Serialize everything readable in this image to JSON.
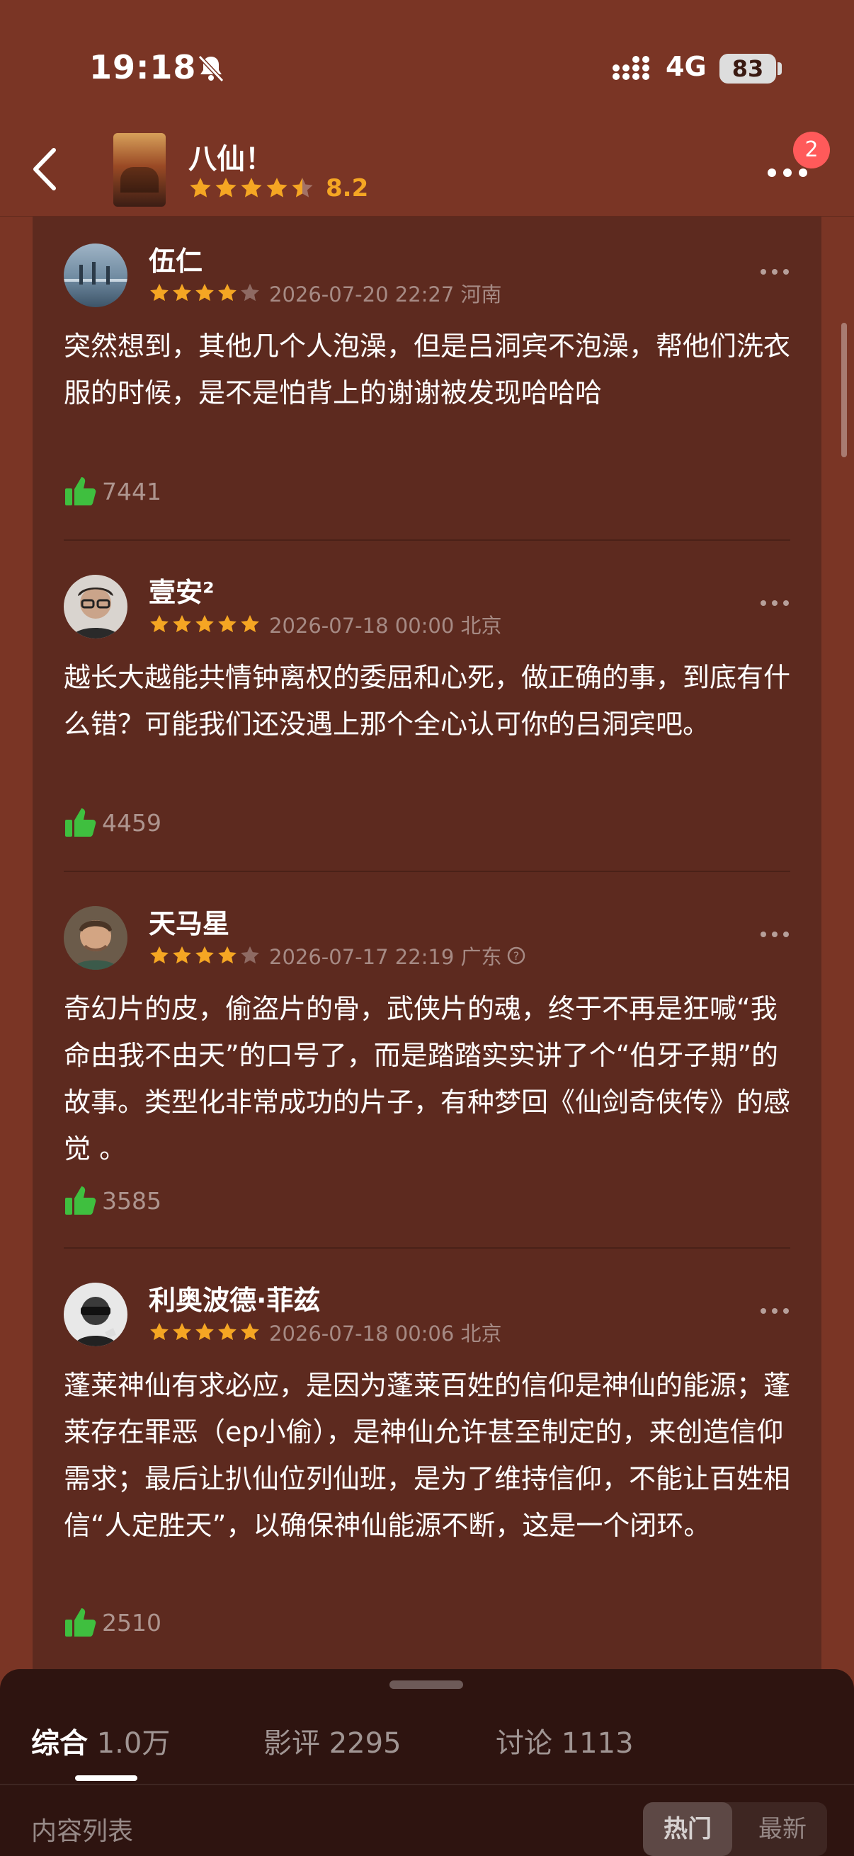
{
  "status_bar": {
    "time": "19:18",
    "network": "4G",
    "battery": "83"
  },
  "header": {
    "back_icon": "chevron-left-icon",
    "title": "八仙！",
    "rating_stars": 4.5,
    "score": "8.2",
    "more_icon": "more-dots-icon",
    "notification_count": "2"
  },
  "reviews": [
    {
      "username": "伍仁",
      "stars": 4,
      "meta": "2026-07-20 22:27 河南",
      "body": "突然想到，其他几个人泡澡，但是吕洞宾不泡澡，帮他们洗衣服的时候，是不是怕背上的谢谢被发现哈哈哈",
      "likes": "7441"
    },
    {
      "username": "壹安²",
      "stars": 5,
      "meta": "2026-07-18 00:00 北京",
      "body": "越长大越能共情钟离权的委屈和心死，做正确的事，到底有什么错？可能我们还没遇上那个全心认可你的吕洞宾吧。",
      "likes": "4459"
    },
    {
      "username": "天马星",
      "stars": 4,
      "meta": "2026-07-17 22:19 广东",
      "body": "奇幻片的皮，偷盗片的骨，武侠片的魂，终于不再是狂喊“我命由我不由天”的口号了，而是踏踏实实讲了个“伯牙子期”的故事。类型化非常成功的片子，有种梦回《仙剑奇侠传》的感觉 。",
      "likes": "3585"
    },
    {
      "username": "利奥波德·菲兹",
      "stars": 5,
      "meta": "2026-07-18 00:06 北京",
      "body": "蓬莱神仙有求必应，是因为蓬莱百姓的信仰是神仙的能源；蓬莱存在罪恶（ep小偷），是神仙允许甚至制定的，来创造信仰需求；最后让扒仙位列仙班，是为了维持信仰，不能让百姓相信“人定胜天”，以确保神仙能源不断，这是一个闭环。",
      "likes": "2510"
    }
  ],
  "bottom_tabs": [
    {
      "label": "综合",
      "count": "1.0万"
    },
    {
      "label": "影评",
      "count": "2295"
    },
    {
      "label": "讨论",
      "count": "1113"
    }
  ],
  "section": {
    "label": "内容列表",
    "sort_hot": "热门",
    "sort_new": "最新"
  },
  "colors": {
    "background": "#7a3525",
    "card": "#5d2a1f",
    "star": "#f5a623",
    "like_green": "#3fbf3f",
    "badge": "#ff5a5a"
  }
}
